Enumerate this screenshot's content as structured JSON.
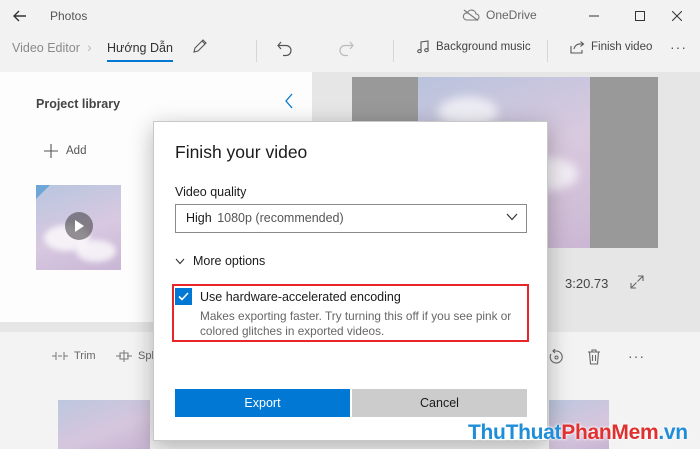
{
  "titlebar": {
    "app_title": "Photos",
    "onedrive_label": "OneDrive"
  },
  "commandbar": {
    "breadcrumb_root": "Video Editor",
    "breadcrumb_sep": "›",
    "project_name": "Hướng Dẫn",
    "background_music_label": "Background music",
    "finish_video_label": "Finish video",
    "more_label": "···"
  },
  "library": {
    "title": "Project library",
    "add_label": "Add"
  },
  "preview": {
    "duration": "3:20.73"
  },
  "storyboard": {
    "trim_label": "Trim",
    "split_label": "Spl",
    "more_label": "···"
  },
  "dialog": {
    "title": "Finish your video",
    "video_quality_label": "Video quality",
    "quality_selected_main": "High",
    "quality_selected_sub": "1080p (recommended)",
    "more_options_label": "More options",
    "hardware_encoding": {
      "checked": true,
      "label": "Use hardware-accelerated encoding",
      "description": "Makes exporting faster. Try turning this off if you see pink or colored glitches in exported videos."
    },
    "export_label": "Export",
    "cancel_label": "Cancel"
  },
  "watermark": {
    "part1": "ThuThuat",
    "part2": "PhanMem",
    "part3": ".vn"
  },
  "colors": {
    "accent": "#0078d4",
    "highlight_box": "#e8262a",
    "watermark_blue": "#1f8ed8",
    "watermark_red": "#e0302f"
  }
}
